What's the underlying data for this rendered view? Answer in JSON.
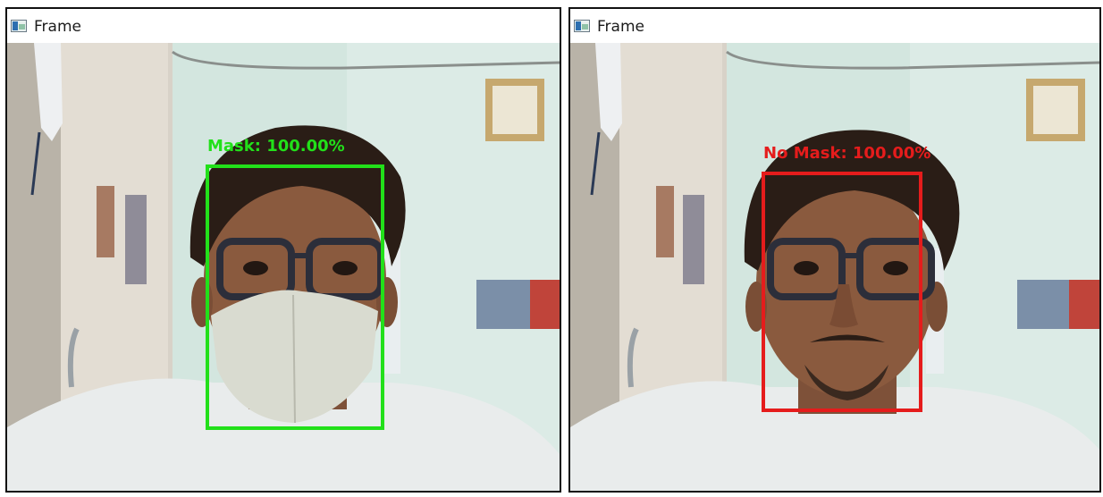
{
  "windows": [
    {
      "title": "Frame",
      "detection": {
        "label": "Mask: 100.00%",
        "status": "mask",
        "confidence": 100.0
      }
    },
    {
      "title": "Frame",
      "detection": {
        "label": "No Mask: 100.00%",
        "status": "no-mask",
        "confidence": 100.0
      }
    }
  ],
  "colors": {
    "mask_box": "#22e01a",
    "no_mask_box": "#e51c1c",
    "wall": "#cfe3dc",
    "shirt": "#e9ecec",
    "skin": "#8a5a3e",
    "hair": "#2a1d16",
    "face_mask": "#d9dbd0"
  }
}
